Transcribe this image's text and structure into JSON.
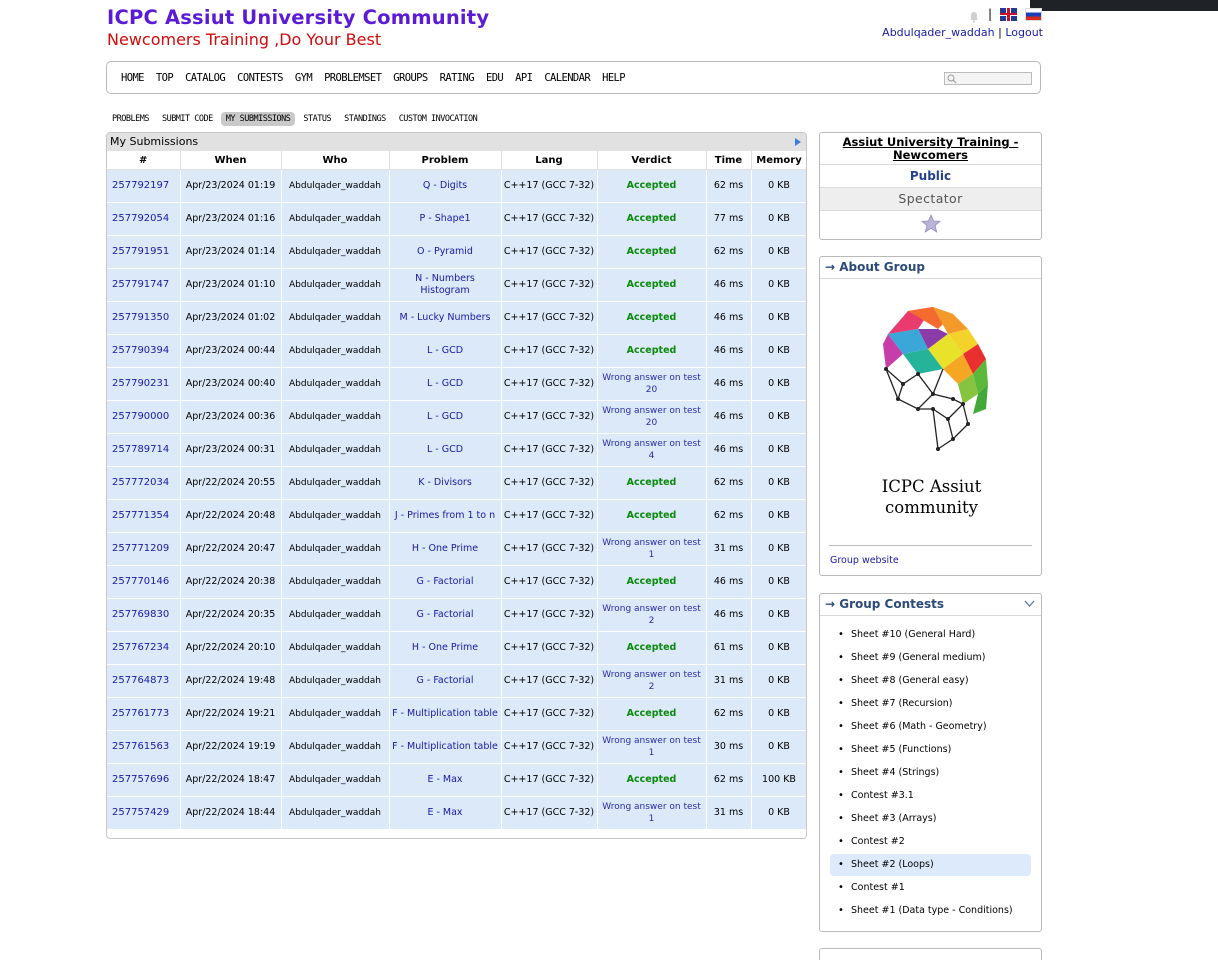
{
  "header": {
    "title": "ICPC Assiut University Community",
    "subtitle": "Newcomers Training ,Do Your Best",
    "username": "Abdulqader_waddah",
    "separator": "|",
    "logout": "Logout"
  },
  "menu": [
    "HOME",
    "TOP",
    "CATALOG",
    "CONTESTS",
    "GYM",
    "PROBLEMSET",
    "GROUPS",
    "RATING",
    "EDU",
    "API",
    "CALENDAR",
    "HELP"
  ],
  "subnav": [
    "PROBLEMS",
    "SUBMIT CODE",
    "MY SUBMISSIONS",
    "STATUS",
    "STANDINGS",
    "CUSTOM INVOCATION"
  ],
  "subnav_active": "MY SUBMISSIONS",
  "submissions": {
    "title": "My Submissions",
    "columns": [
      "#",
      "When",
      "Who",
      "Problem",
      "Lang",
      "Verdict",
      "Time",
      "Memory"
    ],
    "rows": [
      {
        "id": "257792197",
        "when": "Apr/23/2024 01:19",
        "who": "Abdulqader_waddah",
        "problem": "Q - Digits",
        "lang": "C++17 (GCC 7-32)",
        "verdict": "Accepted",
        "time": "62 ms",
        "memory": "0 KB"
      },
      {
        "id": "257792054",
        "when": "Apr/23/2024 01:16",
        "who": "Abdulqader_waddah",
        "problem": "P - Shape1",
        "lang": "C++17 (GCC 7-32)",
        "verdict": "Accepted",
        "time": "77 ms",
        "memory": "0 KB"
      },
      {
        "id": "257791951",
        "when": "Apr/23/2024 01:14",
        "who": "Abdulqader_waddah",
        "problem": "O - Pyramid",
        "lang": "C++17 (GCC 7-32)",
        "verdict": "Accepted",
        "time": "62 ms",
        "memory": "0 KB"
      },
      {
        "id": "257791747",
        "when": "Apr/23/2024 01:10",
        "who": "Abdulqader_waddah",
        "problem": "N - Numbers Histogram",
        "lang": "C++17 (GCC 7-32)",
        "verdict": "Accepted",
        "time": "46 ms",
        "memory": "0 KB"
      },
      {
        "id": "257791350",
        "when": "Apr/23/2024 01:02",
        "who": "Abdulqader_waddah",
        "problem": "M - Lucky Numbers",
        "lang": "C++17 (GCC 7-32)",
        "verdict": "Accepted",
        "time": "46 ms",
        "memory": "0 KB"
      },
      {
        "id": "257790394",
        "when": "Apr/23/2024 00:44",
        "who": "Abdulqader_waddah",
        "problem": "L - GCD",
        "lang": "C++17 (GCC 7-32)",
        "verdict": "Accepted",
        "time": "46 ms",
        "memory": "0 KB"
      },
      {
        "id": "257790231",
        "when": "Apr/23/2024 00:40",
        "who": "Abdulqader_waddah",
        "problem": "L - GCD",
        "lang": "C++17 (GCC 7-32)",
        "verdict": "Wrong answer on test 20",
        "time": "46 ms",
        "memory": "0 KB"
      },
      {
        "id": "257790000",
        "when": "Apr/23/2024 00:36",
        "who": "Abdulqader_waddah",
        "problem": "L - GCD",
        "lang": "C++17 (GCC 7-32)",
        "verdict": "Wrong answer on test 20",
        "time": "46 ms",
        "memory": "0 KB"
      },
      {
        "id": "257789714",
        "when": "Apr/23/2024 00:31",
        "who": "Abdulqader_waddah",
        "problem": "L - GCD",
        "lang": "C++17 (GCC 7-32)",
        "verdict": "Wrong answer on test 4",
        "time": "46 ms",
        "memory": "0 KB"
      },
      {
        "id": "257772034",
        "when": "Apr/22/2024 20:55",
        "who": "Abdulqader_waddah",
        "problem": "K - Divisors",
        "lang": "C++17 (GCC 7-32)",
        "verdict": "Accepted",
        "time": "62 ms",
        "memory": "0 KB"
      },
      {
        "id": "257771354",
        "when": "Apr/22/2024 20:48",
        "who": "Abdulqader_waddah",
        "problem": "J - Primes from 1 to n",
        "lang": "C++17 (GCC 7-32)",
        "verdict": "Accepted",
        "time": "62 ms",
        "memory": "0 KB"
      },
      {
        "id": "257771209",
        "when": "Apr/22/2024 20:47",
        "who": "Abdulqader_waddah",
        "problem": "H - One Prime",
        "lang": "C++17 (GCC 7-32)",
        "verdict": "Wrong answer on test 1",
        "time": "31 ms",
        "memory": "0 KB"
      },
      {
        "id": "257770146",
        "when": "Apr/22/2024 20:38",
        "who": "Abdulqader_waddah",
        "problem": "G - Factorial",
        "lang": "C++17 (GCC 7-32)",
        "verdict": "Accepted",
        "time": "46 ms",
        "memory": "0 KB"
      },
      {
        "id": "257769830",
        "when": "Apr/22/2024 20:35",
        "who": "Abdulqader_waddah",
        "problem": "G - Factorial",
        "lang": "C++17 (GCC 7-32)",
        "verdict": "Wrong answer on test 2",
        "time": "46 ms",
        "memory": "0 KB"
      },
      {
        "id": "257767234",
        "when": "Apr/22/2024 20:10",
        "who": "Abdulqader_waddah",
        "problem": "H - One Prime",
        "lang": "C++17 (GCC 7-32)",
        "verdict": "Accepted",
        "time": "61 ms",
        "memory": "0 KB"
      },
      {
        "id": "257764873",
        "when": "Apr/22/2024 19:48",
        "who": "Abdulqader_waddah",
        "problem": "G - Factorial",
        "lang": "C++17 (GCC 7-32)",
        "verdict": "Wrong answer on test 2",
        "time": "31 ms",
        "memory": "0 KB"
      },
      {
        "id": "257761773",
        "when": "Apr/22/2024 19:21",
        "who": "Abdulqader_waddah",
        "problem": "F - Multiplication table",
        "lang": "C++17 (GCC 7-32)",
        "verdict": "Accepted",
        "time": "62 ms",
        "memory": "0 KB"
      },
      {
        "id": "257761563",
        "when": "Apr/22/2024 19:19",
        "who": "Abdulqader_waddah",
        "problem": "F - Multiplication table",
        "lang": "C++17 (GCC 7-32)",
        "verdict": "Wrong answer on test 1",
        "time": "30 ms",
        "memory": "0 KB"
      },
      {
        "id": "257757696",
        "when": "Apr/22/2024 18:47",
        "who": "Abdulqader_waddah",
        "problem": "E - Max",
        "lang": "C++17 (GCC 7-32)",
        "verdict": "Accepted",
        "time": "62 ms",
        "memory": "100 KB"
      },
      {
        "id": "257757429",
        "when": "Apr/22/2024 18:44",
        "who": "Abdulqader_waddah",
        "problem": "E - Max",
        "lang": "C++17 (GCC 7-32)",
        "verdict": "Wrong answer on test 1",
        "time": "31 ms",
        "memory": "0 KB"
      }
    ]
  },
  "group_panel": {
    "title": "Assiut University Training - Newcomers",
    "visibility": "Public",
    "role": "Spectator"
  },
  "about": {
    "heading": "→ About Group",
    "logo_text_line1": "ICPC Assiut",
    "logo_text_line2": "community",
    "website_link": "Group website"
  },
  "contests": {
    "heading": "→ Group Contests",
    "items": [
      "Sheet #10 (General Hard)",
      "Sheet #9 (General medium)",
      "Sheet #8 (General easy)",
      "Sheet #7 (Recursion)",
      "Sheet #6 (Math - Geometry)",
      "Sheet #5 (Functions)",
      "Sheet #4 (Strings)",
      "Contest #3.1",
      "Sheet #3 (Arrays)",
      "Contest #2",
      "Sheet #2 (Loops)",
      "Contest #1",
      "Sheet #1 (Data type - Conditions)"
    ],
    "highlighted": "Sheet #2 (Loops)"
  },
  "colors": {
    "title": "#5b1bd6",
    "subtitle": "#d10a0a",
    "accepted": "#0a8a0a",
    "wrong": "#2d2da8",
    "row_bg": "#dbe9f9",
    "link": "#1a1aa6"
  }
}
